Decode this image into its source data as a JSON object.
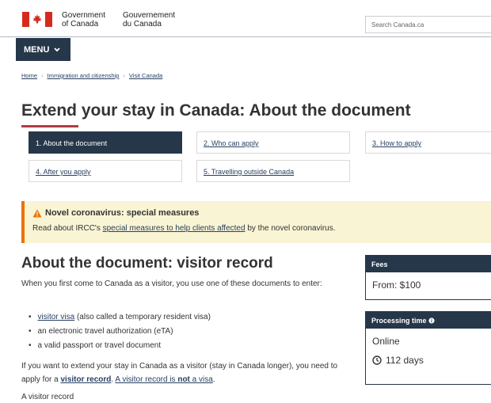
{
  "header": {
    "signature_en_line1": "Government",
    "signature_en_line2": "of Canada",
    "signature_fr_line1": "Gouvernement",
    "signature_fr_line2": "du Canada",
    "search_placeholder": "Search Canada.ca",
    "flag_color": "#d52b1e"
  },
  "menu": {
    "label": "MENU"
  },
  "breadcrumb": [
    "Home",
    "Immigration and citizenship",
    "Visit Canada"
  ],
  "page_title": "Extend your stay in Canada: About the document",
  "tabs": [
    {
      "label": "1. About the document",
      "active": true
    },
    {
      "label": "2. Who can apply",
      "active": false
    },
    {
      "label": "3. How to apply",
      "active": false
    },
    {
      "label": "4. After you apply",
      "active": false
    },
    {
      "label": "5. Travelling outside Canada",
      "active": false
    }
  ],
  "alert": {
    "title": "Novel coronavirus: special measures",
    "text_before": "Read about IRCC's ",
    "link": "special measures to help clients affected",
    "text_after": " by the novel coronavirus."
  },
  "section": {
    "heading": "About the document: visitor record",
    "intro": "When you first come to Canada as a visitor, you use one of these documents to enter:",
    "bullets": [
      {
        "link": "visitor visa",
        "rest": " (also called a temporary resident visa)"
      },
      {
        "link": "",
        "rest": "an electronic travel authorization (eTA)"
      },
      {
        "link": "",
        "rest": "a valid passport or travel document"
      }
    ],
    "extend_p1": "If you want to extend your stay in Canada as a visitor (stay in Canada longer), you need to apply for a ",
    "extend_link1": "visitor record",
    "extend_p2": ". ",
    "extend_link2a": "A visitor record is ",
    "extend_link2b": "not",
    "extend_link2c": " a visa",
    "extend_p3": ".",
    "last_line": "A visitor record"
  },
  "fees": {
    "title": "Fees",
    "value": "From: $100"
  },
  "processing": {
    "title": "Processing time",
    "mode": "Online",
    "duration": "112 days"
  },
  "colors": {
    "navy": "#26374a",
    "alert_bg": "#f9f4d4",
    "alert_border": "#ee7100",
    "link": "#284162"
  }
}
